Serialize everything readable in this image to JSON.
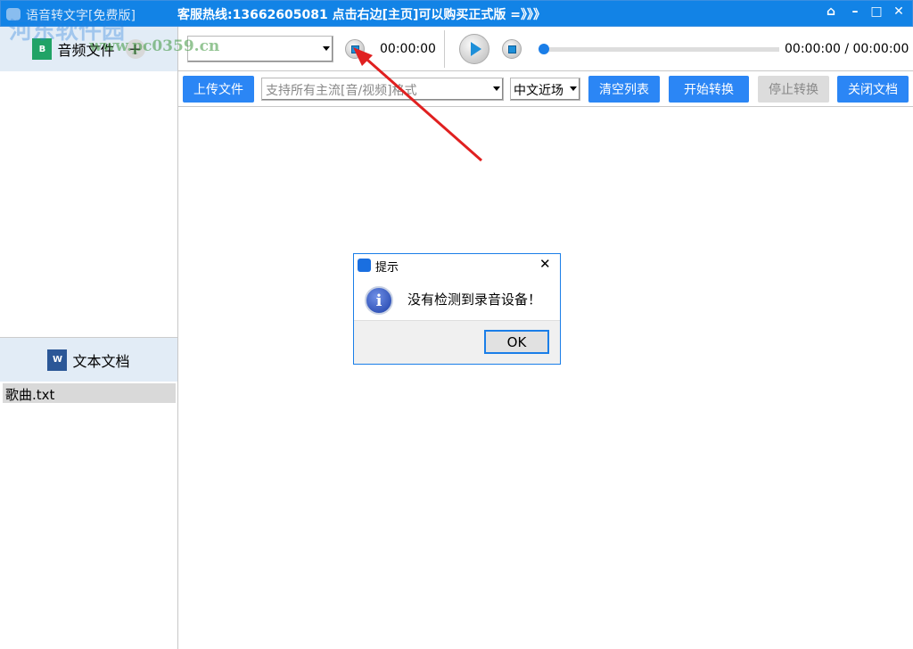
{
  "titlebar": {
    "app_title": "语音转文字[免费版]",
    "hotline": "客服热线:13662605081  点击右边[主页]可以购买正式版 =》》》",
    "home": "⌂",
    "minimize": "–",
    "maximize": "□",
    "close": "✕"
  },
  "sidebar": {
    "audio_label": "音频文件",
    "audio_add": "+",
    "text_label": "文本文档",
    "files": [
      "歌曲.txt"
    ]
  },
  "player": {
    "device_value": "",
    "record_time": "00:00:00",
    "progress": 0,
    "time_display": "00:00:00 / 00:00:00"
  },
  "toolbar": {
    "upload": "上传文件",
    "format_placeholder": "支持所有主流[音/视频]格式",
    "language": "中文近场",
    "clear": "清空列表",
    "start": "开始转换",
    "stop": "停止转换",
    "close_doc": "关闭文档"
  },
  "dialog": {
    "title": "提示",
    "message": "没有检测到录音设备！",
    "ok": "OK",
    "close": "✕"
  },
  "watermark": {
    "name": "河东软件园",
    "url": "www.pc0359.cn"
  },
  "colors": {
    "accent": "#2b86f5",
    "titlebar": "#1283e6"
  }
}
